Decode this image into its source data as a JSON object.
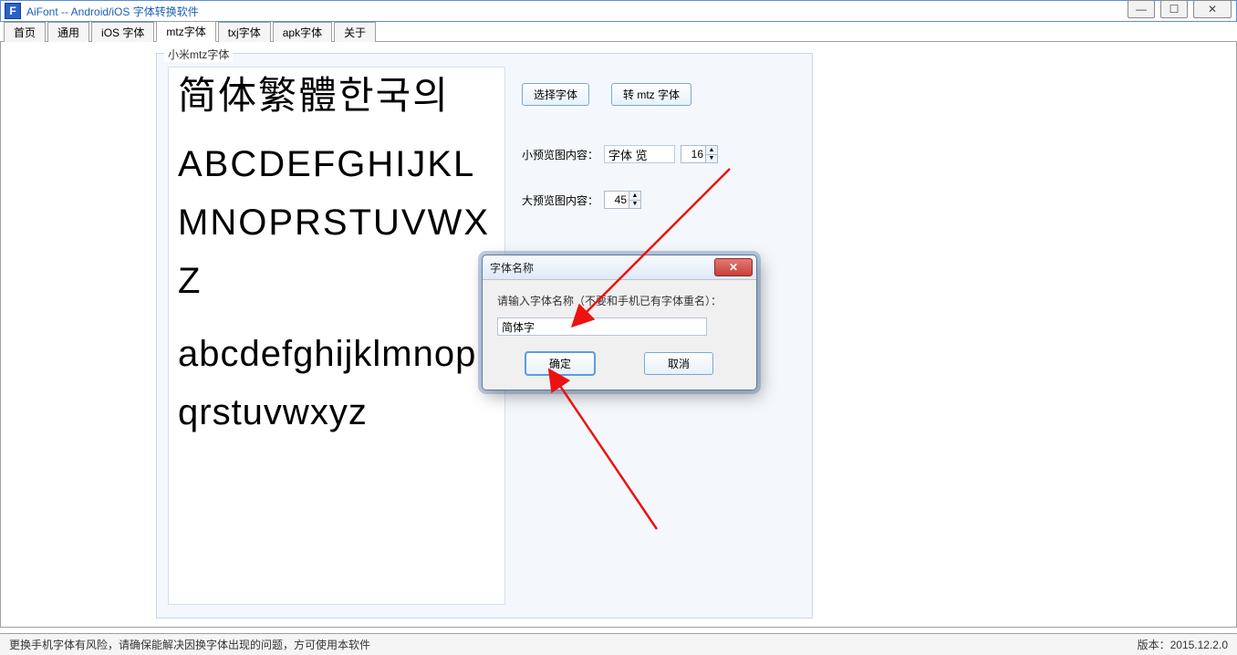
{
  "window": {
    "app_icon_letter": "F",
    "title": "AiFont -- Android/iOS 字体转换软件"
  },
  "win_controls": {
    "min": "—",
    "max": "☐",
    "close": "✕"
  },
  "tabs": [
    {
      "label": "首页"
    },
    {
      "label": "通用"
    },
    {
      "label": "iOS 字体"
    },
    {
      "label": "mtz字体"
    },
    {
      "label": "txj字体"
    },
    {
      "label": "apk字体"
    },
    {
      "label": "关于"
    }
  ],
  "group": {
    "title": "小米mtz字体",
    "buttons": {
      "select_font": "选择字体",
      "convert": "转 mtz 字体"
    },
    "small_preview_label": "小预览图内容：",
    "small_preview_value": "字体 览",
    "small_preview_size": "16",
    "big_preview_label": "大预览图内容：",
    "big_preview_size": "45",
    "preview": {
      "line_cjk": "简体繁體한국의",
      "line_upper": "ABCDEFGHIJKLMNOPRSTUVWXZ",
      "line_lower": "abcdefghijklmnopqrstuvwxyz"
    }
  },
  "dialog": {
    "title": "字体名称",
    "prompt": "请输入字体名称（不要和手机已有字体重名）：",
    "input_value": "简体字",
    "ok": "确定",
    "cancel": "取消"
  },
  "status": {
    "left": "更换手机字体有风险，请确保能解决因换字体出现的问题，方可使用本软件",
    "right": "版本：2015.12.2.0"
  }
}
